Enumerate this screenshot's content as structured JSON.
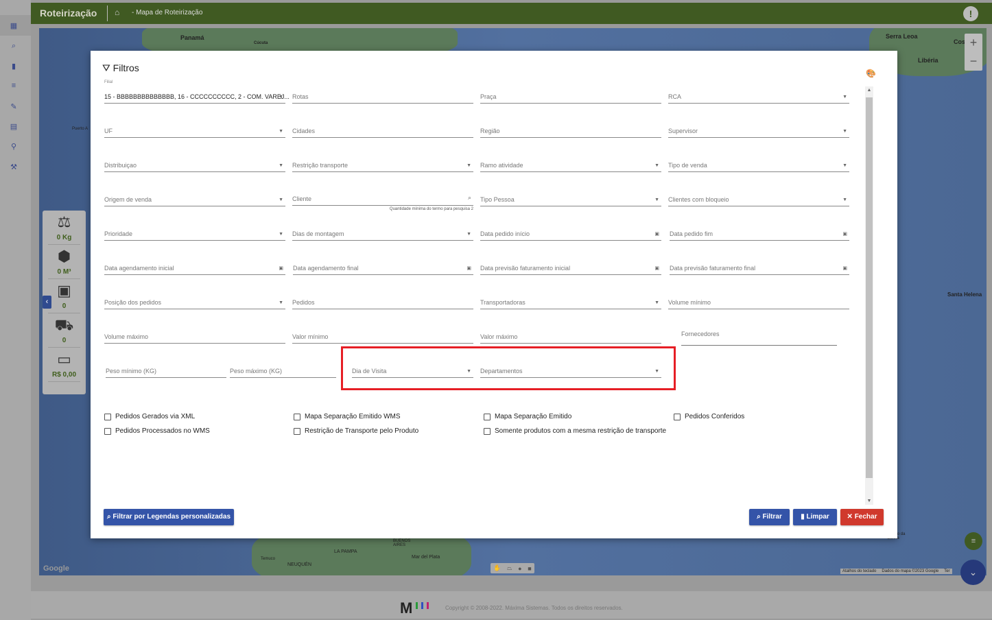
{
  "header": {
    "app_title": "Roteirização",
    "breadcrumb": "- Mapa de Roteirização"
  },
  "sidebar": {
    "items": [
      "map-icon",
      "search-icon",
      "chart-icon",
      "list-icon",
      "edit-icon",
      "document-icon",
      "pin-icon",
      "tools-icon"
    ]
  },
  "map": {
    "labels": [
      "Panamá",
      "Cúcuta",
      "Serra Leoa",
      "Libéria",
      "Cos Ma",
      "Santa Helena",
      "Puerto A",
      "LA PAMPA",
      "BUENOS AIRES",
      "Mar del Plata",
      "NEUQUÉN",
      "Temuco",
      "Tristão da Cunha",
      "Google"
    ],
    "attribution": [
      "Atalhos do teclado",
      "Dados do mapa ©2023 Google",
      "Ter"
    ]
  },
  "stats": [
    {
      "icon": "weight-icon",
      "value": "0 Kg"
    },
    {
      "icon": "boxes-icon",
      "value": "0 M³"
    },
    {
      "icon": "package-icon",
      "value": "0"
    },
    {
      "icon": "truck-icon",
      "value": "0"
    },
    {
      "icon": "money-icon",
      "value": "R$ 0,00"
    }
  ],
  "modal": {
    "title": "Filtros",
    "filial": {
      "label": "Filial",
      "value": "15 - BBBBBBBBBBBBBB, 16 - CCCCCCCCCC, 2 - COM. VAREJ..."
    },
    "fields": [
      "Rotas",
      "Praça",
      "RCA",
      "UF",
      "Cidades",
      "Região",
      "Supervisor",
      "Distribuiçao",
      "Restrição transporte",
      "Ramo atividade",
      "Tipo de venda",
      "Origem de venda",
      "Cliente",
      "Tipo Pessoa",
      "Clientes com bloqueio",
      "Prioridade",
      "Dias de montagem",
      "Data pedido início",
      "Data pedido fim",
      "Data agendamento inicial",
      "Data agendamento final",
      "Data previsão faturamento inicial",
      "Data previsão faturamento final",
      "Posição dos pedidos",
      "Pedidos",
      "Transportadoras",
      "Volume mínimo",
      "Volume máximo",
      "Valor mínimo",
      "Valor máximo",
      "Fornecedores",
      "Peso mínimo (KG)",
      "Peso máximo (KG)",
      "Dia de Visita",
      "Departamentos"
    ],
    "cliente_hint": "Quantidade mínima do termo para pesquisa 2",
    "checkboxes": [
      {
        "label": "Pedidos Gerados via XML",
        "checked": false
      },
      {
        "label": "Mapa Separação Emitido WMS",
        "checked": false
      },
      {
        "label": "Mapa Separação Emitido",
        "checked": false
      },
      {
        "label": "Pedidos Conferidos",
        "checked": false
      },
      {
        "label": "Pedidos Processados no WMS",
        "checked": false
      },
      {
        "label": "Restrição de Transporte pelo Produto",
        "checked": false
      },
      {
        "label": "Somente produtos com a mesma restrição de transporte",
        "checked": false
      }
    ],
    "buttons": {
      "legendas": "Filtrar por Legendas personalizadas",
      "filtrar": "Filtrar",
      "limpar": "Limpar",
      "fechar": "Fechar"
    }
  },
  "footer": {
    "copyright": "Copyright © 2008-2022. Máxima Sistemas. Todos os direitos reservados.",
    "logo": "M"
  },
  "colors": {
    "header": "#405a22",
    "primary": "#3454a8",
    "danger": "#d0392d",
    "highlight": "#e61e25"
  }
}
